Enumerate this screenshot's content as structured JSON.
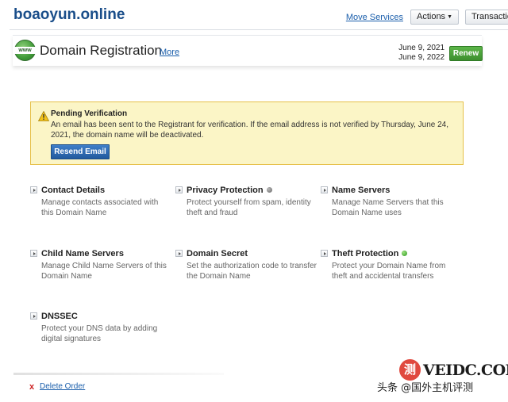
{
  "header": {
    "domain": "boaoyun.online",
    "move_services": "Move Services",
    "actions": "Actions",
    "transactions": "Transactions"
  },
  "panel": {
    "icon_text": "www",
    "title": "Domain Registration",
    "more": "More",
    "date_start": "June 9, 2021",
    "date_end": "June 9, 2022",
    "renew": "Renew"
  },
  "notice": {
    "title": "Pending Verification",
    "text": "An email has been sent to the Registrant for verification. If the email address is not verified by Thursday, June 24, 2021, the domain name will be deactivated.",
    "button": "Resend Email"
  },
  "options": [
    {
      "title": "Contact Details",
      "desc": "Manage contacts associated with this Domain Name"
    },
    {
      "title": "Privacy Protection",
      "desc": "Protect yourself from spam, identity theft and fraud",
      "status": "off"
    },
    {
      "title": "Name Servers",
      "desc": "Manage Name Servers that this Domain Name uses"
    },
    {
      "title": "Child Name Servers",
      "desc": "Manage Child Name Servers of this Domain Name"
    },
    {
      "title": "Domain Secret",
      "desc": "Set the authorization code to transfer the Domain Name"
    },
    {
      "title": "Theft Protection",
      "desc": "Protect your Domain Name from theft and accidental transfers",
      "status": "on"
    },
    {
      "title": "DNSSEC",
      "desc": "Protect your DNS data by adding digital signatures"
    }
  ],
  "footer": {
    "delete_x": "x",
    "delete": "Delete Order"
  },
  "watermark": {
    "logo": "测",
    "brand": "VEIDC.COM",
    "caption": "头条 @国外主机评测"
  },
  "colors": {
    "link": "#1a5eab",
    "renew_green": "#4aa23a",
    "notice_bg": "#fbf5c6",
    "notice_border": "#e6c04a",
    "button_blue": "#2d6bb3"
  }
}
